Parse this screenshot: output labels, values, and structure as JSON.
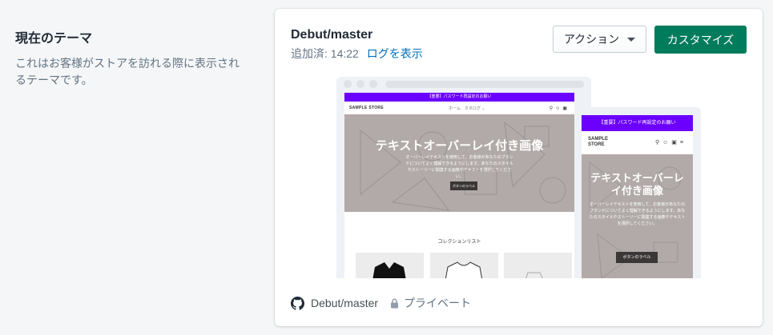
{
  "section": {
    "title": "現在のテーマ",
    "description": "これはお客様がストアを訪れる際に表示されるテーマです。"
  },
  "theme": {
    "name": "Debut/master",
    "added_label": "追加済: 14:22",
    "log_link": "ログを表示",
    "actions_label": "アクション",
    "customize_label": "カスタマイズ"
  },
  "preview": {
    "announcement": "【重要】パスワード再設定のお願い",
    "store_name": "SAMPLE STORE",
    "store_name_mobile": "SAMPLE STORE",
    "nav_menu": "ホーム　カタログ ⌄",
    "hero_title": "テキストオーバーレイ付き画像",
    "hero_text": "オーバーレイテキストを使用して、お客様があなたのブランドについてよく理解できるようにします。あなたのスタイルやストーリーに関連する画像やテキストを選択してください。",
    "hero_button": "ボタンのラベル",
    "collection_title": "コレクションリスト"
  },
  "footer": {
    "repo": "Debut/master",
    "visibility": "プライベート"
  },
  "colors": {
    "primary": "#007b5c",
    "link": "#006fbb",
    "announcement_bar": "#6b00ff",
    "hero_bg": "#b1aaa8"
  }
}
